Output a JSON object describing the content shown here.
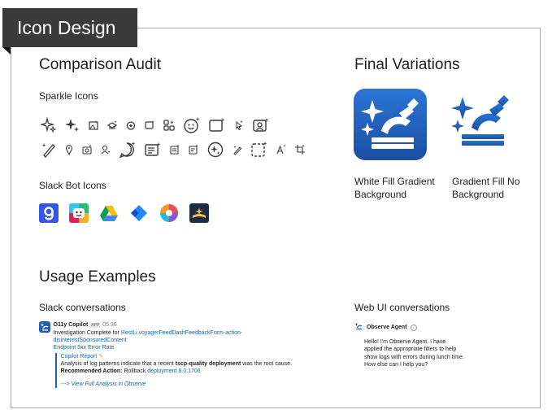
{
  "tag": {
    "title": "Icon Design"
  },
  "audit": {
    "title": "Comparison Audit",
    "sparkle_title": "Sparkle Icons",
    "bot_title": "Slack Bot Icons"
  },
  "final": {
    "title": "Final Variations",
    "variant1_label": "White Fill Gradient Background",
    "variant2_label": "Gradient Fill No Background"
  },
  "usage": {
    "title": "Usage Examples",
    "slack_title": "Slack conversations",
    "web_title": "Web UI conversations"
  },
  "slack": {
    "bot_name": "O11y Copilot",
    "app_badge": "APP",
    "time": "05:36",
    "line1_prefix": "Investigation Complete for ",
    "line1_link": "RestLi voyagerFeedDashFeedbackForm-action-disinterestSponsoredContent",
    "line2_link": "Endpoint 5xx Error Rate",
    "report_title": "Copilot Report",
    "report_line1_prefix": "Analysis of log patterns indicate that a recent ",
    "report_line1_bold": "tscp-quality deployment",
    "report_line1_suffix": " was the root cause.",
    "report_line2_bold": "Recommended Action:",
    "report_line2_text": " Rollback ",
    "report_line2_link": "deployment 8.0.1706",
    "view_link": "---> View Full Analysis in Observe"
  },
  "web": {
    "agent_name": "Observe Agent",
    "message": "Hello! I'm Observe Agent. I have applied the appropriate filters to help show logs with errors during lunch time. How else can I help you?"
  },
  "colors": {
    "brand_blue": "#1e5fb3",
    "link_blue": "#1264a3",
    "tag_bg": "#3a3a3a"
  }
}
